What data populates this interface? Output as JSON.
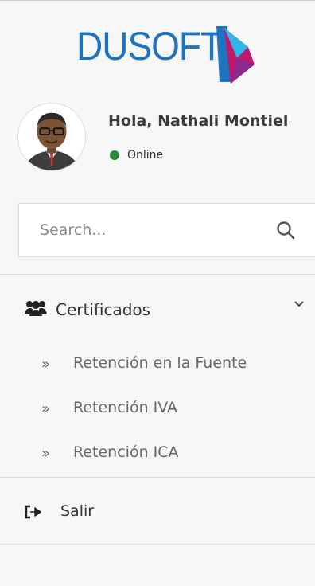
{
  "brand": {
    "logo_text": "DUSOFT",
    "logo_color": "#1f74bf"
  },
  "user": {
    "greeting": "Hola, Nathali Montiel",
    "status_text": "Online",
    "status_color": "#2a8a3a",
    "avatar_icon": "user-avatar-icon"
  },
  "search": {
    "placeholder": "Search...",
    "value": "",
    "icon": "search-icon"
  },
  "menu": {
    "section": {
      "label": "Certificados",
      "icon": "users-icon",
      "expanded": true,
      "chevron_icon": "chevron-down-icon",
      "items": [
        {
          "label": "Retención en la Fuente",
          "icon": "double-angle-right-icon",
          "arrow": "»"
        },
        {
          "label": "Retención IVA",
          "icon": "double-angle-right-icon",
          "arrow": "»"
        },
        {
          "label": "Retención ICA",
          "icon": "double-angle-right-icon",
          "arrow": "»"
        }
      ]
    },
    "logout": {
      "label": "Salir",
      "icon": "sign-out-icon"
    }
  }
}
